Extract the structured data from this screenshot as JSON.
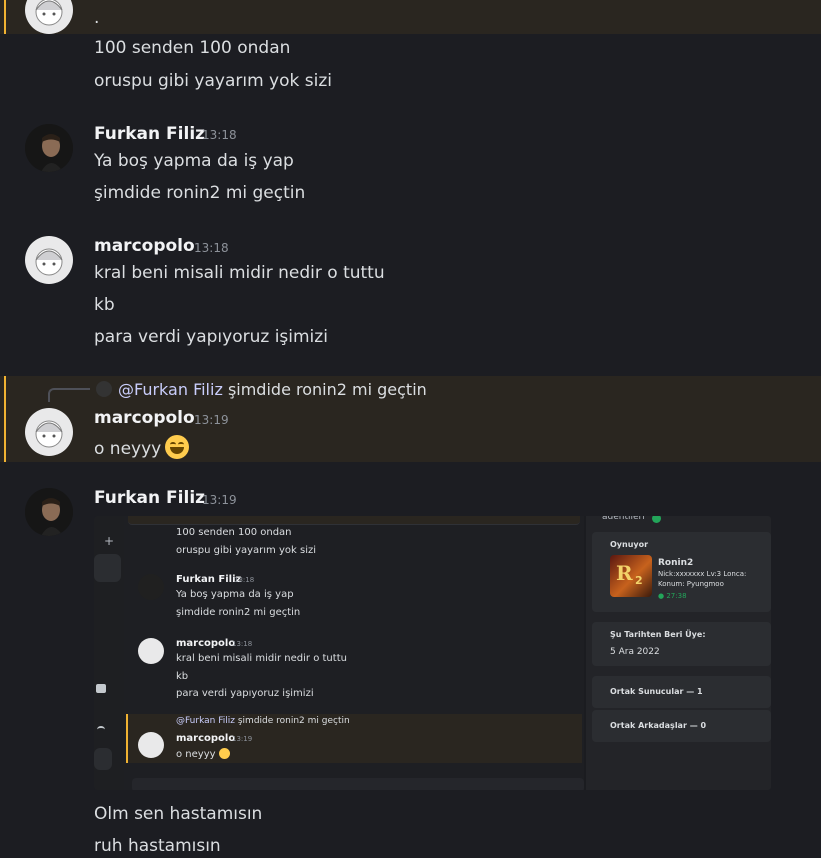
{
  "messages": {
    "m0": {
      "line1": ".",
      "line2": "100 senden 100 ondan",
      "line3": "oruspu gibi yayarım yok sizi"
    },
    "m1": {
      "author": "Furkan Filiz",
      "time": "13:18",
      "line1": "Ya boş yapma da iş yap",
      "line2": "şimdide ronin2 mi geçtin"
    },
    "m2": {
      "author": "marcopolo",
      "time": "13:18",
      "line1": "kral beni misali midir nedir o tuttu",
      "line2": "kb",
      "line3": "para verdi yapıyoruz işimizi"
    },
    "m3": {
      "reply_mention": "@Furkan Filiz",
      "reply_text": "şimdide ronin2 mi geçtin",
      "author": "marcopolo",
      "time": "13:19",
      "line1": "o neyyy",
      "emoji": "grinning-face-emoji"
    },
    "m4": {
      "author": "Furkan Filiz",
      "time": "13:19",
      "line1": "Olm sen hastamısın",
      "line2": "ruh hastamısın"
    }
  },
  "embedded_screenshot": {
    "line1": "100 senden 100 ondan",
    "line2": "oruspu gibi yayarım yok sizi",
    "m1_author": "Furkan Filiz",
    "m1_time": "13:18",
    "m1_line1": "Ya boş yapma da iş yap",
    "m1_line2": "şimdide ronin2 mi geçtin",
    "m2_author": "marcopolo",
    "m2_time": "13:18",
    "m2_line1": "kral beni misali midir nedir o tuttu",
    "m2_line2": "kb",
    "m2_line3": "para verdi yapıyoruz işimizi",
    "m3_reply_mention": "@Furkan Filiz",
    "m3_reply_text": "şimdide ronin2 mi geçtin",
    "m3_author": "marcopolo",
    "m3_time": "13:19",
    "m3_line1": "o neyyy",
    "profile": {
      "top_text": "adentileri",
      "playing_label": "Oynuyor",
      "game_name": "Ronin2",
      "game_detail1": "Nick:xxxxxxx Lv:3 Lonca:",
      "game_detail2": "Konum: Pyungmoo",
      "game_elapsed": "27:38",
      "member_since_label": "Şu Tarihten Beri Üye:",
      "member_since": "5 Ara 2022",
      "mutual_servers": "Ortak Sunucular — 1",
      "mutual_friends": "Ortak Arkadaşlar — 0"
    }
  },
  "colors": {
    "background": "#1c1d22",
    "highlight": "#2a2620",
    "mention_bar": "#f0b232"
  }
}
